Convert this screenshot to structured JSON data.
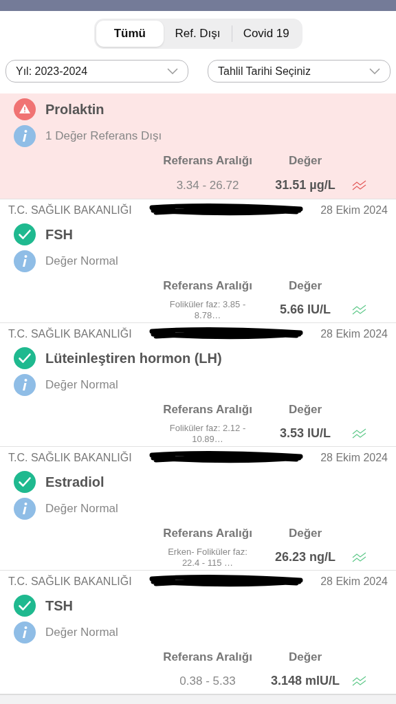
{
  "tabs": [
    {
      "label": "Tümü",
      "selected": true
    },
    {
      "label": "Ref. Dışı",
      "selected": false
    },
    {
      "label": "Covid 19",
      "selected": false
    }
  ],
  "filters": [
    {
      "value": "Yıl: 2023-2024"
    },
    {
      "value": "Tahlil Tarihi Seçiniz"
    }
  ],
  "results": [
    {
      "kind": "out",
      "name": "Prolaktin",
      "note": "1 Değer Referans Dışı",
      "ref_label": "Referans Aralığı",
      "value_label": "Değer",
      "ref_range": [
        "3.34 - 26.72"
      ],
      "value": "31.51 µg/L"
    },
    {
      "kind": "normal",
      "source": "T.C. SAĞLIK BAKANLIĞI",
      "date": "28 Ekim 2024",
      "name": "FSH",
      "note": "Değer Normal",
      "ref_label": "Referans Aralığı",
      "value_label": "Değer",
      "ref_range": [
        "Foliküler faz:  3.85 -",
        "8.78…"
      ],
      "value": "5.66 IU/L"
    },
    {
      "kind": "normal",
      "source": "T.C. SAĞLIK BAKANLIĞI",
      "date": "28 Ekim 2024",
      "name": "Lüteinleştiren hormon (LH)",
      "note": "Değer Normal",
      "ref_label": "Referans Aralığı",
      "value_label": "Değer",
      "ref_range": [
        "Foliküler faz:  2.12 -",
        "10.89…"
      ],
      "value": "3.53 IU/L"
    },
    {
      "kind": "normal",
      "source": "T.C. SAĞLIK BAKANLIĞI",
      "date": "28 Ekim 2024",
      "name": "Estradiol",
      "note": "Değer Normal",
      "ref_label": "Referans Aralığı",
      "value_label": "Değer",
      "ref_range": [
        "Erken- Foliküler faz:",
        "22.4 - 115 …"
      ],
      "value": "26.23 ng/L"
    },
    {
      "kind": "normal",
      "source": "T.C. SAĞLIK BAKANLIĞI",
      "date": "28 Ekim 2024",
      "name": "TSH",
      "note": "Değer Normal",
      "ref_label": "Referans Aralığı",
      "value_label": "Değer",
      "ref_range": [
        "0.38 - 5.33"
      ],
      "value": "3.148 mIU/L"
    }
  ]
}
